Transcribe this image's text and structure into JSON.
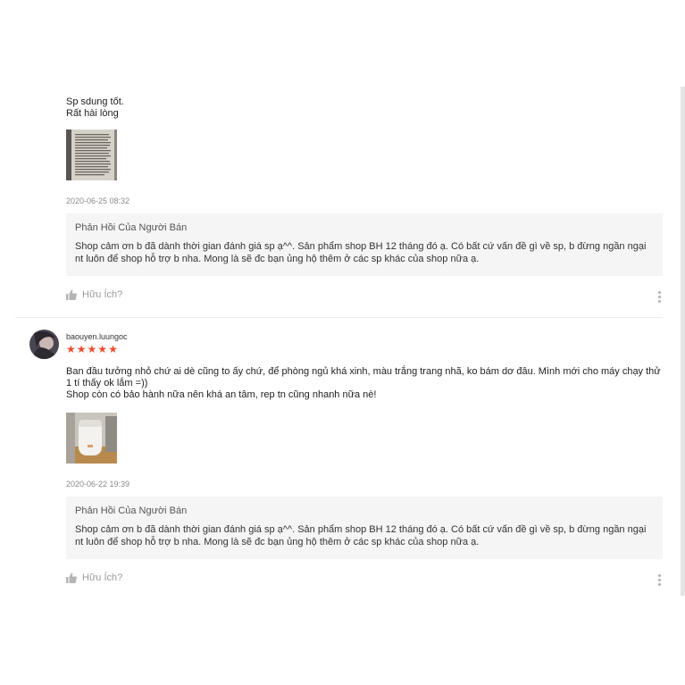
{
  "reviews": [
    {
      "text": [
        "Sp sdung tốt.",
        "Rất hài lòng"
      ],
      "timestamp": "2020-06-25 08:32",
      "photo_icon": "book-page-photo",
      "seller_reply": {
        "title": "Phản Hồi Của Người Bán",
        "body": "Shop cảm ơn b đã dành thời gian đánh giá sp ạ^^. Sản phẩm shop BH 12 tháng đó ạ. Có bất cứ vấn đề gì về sp, b đừng ngần ngại nt luôn để shop hỗ trợ b nha. Mong là sẽ đc bạn ủng hộ thêm ở các sp khác của shop nữa ạ."
      },
      "helpful_label": "Hữu Ích?"
    },
    {
      "username": "baouyen.luungoc",
      "rating": 5,
      "text": [
        "Ban đầu tưởng nhỏ chứ ai dè cũng to ấy chứ, để phòng ngủ khá xinh, màu trắng trang nhã, ko bám dơ đâu. Mình mới cho máy chạy thử 1 tí thấy ok lắm =))",
        "Shop còn có bảo hành nữa nên khá an tâm, rep tn cũng nhanh nữa nè!"
      ],
      "timestamp": "2020-06-22 19:39",
      "photo_icon": "humidifier-photo",
      "seller_reply": {
        "title": "Phản Hồi Của Người Bán",
        "body": "Shop cảm ơn b đã dành thời gian đánh giá sp ạ^^. Sản phẩm shop BH 12 tháng đó ạ. Có bất cứ vấn đề gì về sp, b đừng ngần ngại nt luôn để shop hỗ trợ b nha. Mong là sẽ đc bạn ủng hộ thêm ở các sp khác của shop nữa ạ."
      },
      "helpful_label": "Hữu Ích?"
    }
  ],
  "colors": {
    "star": "#ee4d2d",
    "seller_box_bg": "#f5f5f5",
    "timestamp": "#8a8a8a"
  }
}
